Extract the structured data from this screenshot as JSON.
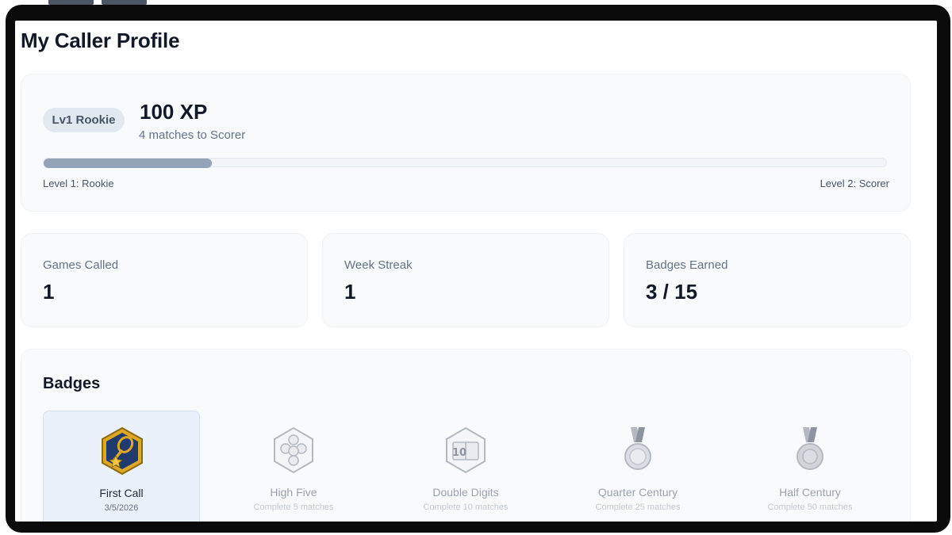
{
  "page": {
    "title": "My Caller Profile"
  },
  "level": {
    "pill": "Lv1 Rookie",
    "xp": "100 XP",
    "subtitle": "4 matches to Scorer",
    "progress_fraction": 0.2,
    "current_level": "Level 1: Rookie",
    "next_level": "Level 2: Scorer"
  },
  "stats": [
    {
      "label": "Games Called",
      "value": "1"
    },
    {
      "label": "Week Streak",
      "value": "1"
    },
    {
      "label": "Badges Earned",
      "value": "3 / 15"
    }
  ],
  "badges": {
    "heading": "Badges",
    "items": [
      {
        "name": "First Call",
        "sub": "3/5/2026",
        "icon": "tennis-racket-star-icon",
        "earned": true
      },
      {
        "name": "High Five",
        "sub": "Complete 5 matches",
        "icon": "five-balls-icon",
        "earned": false
      },
      {
        "name": "Double Digits",
        "sub": "Complete 10 matches",
        "icon": "scoreboard-10-icon",
        "earned": false,
        "icon_text": "10"
      },
      {
        "name": "Quarter Century",
        "sub": "Complete 25 matches",
        "icon": "silver-medal-icon",
        "earned": false
      },
      {
        "name": "Half Century",
        "sub": "Complete 50 matches",
        "icon": "silver-medal-icon",
        "earned": false
      }
    ]
  },
  "colors": {
    "progress_fill": "#94a3b8",
    "badge_gold": "#e0a722",
    "badge_navy": "#1f3b6f",
    "earned_badge_bg": "#eaf1fb"
  }
}
